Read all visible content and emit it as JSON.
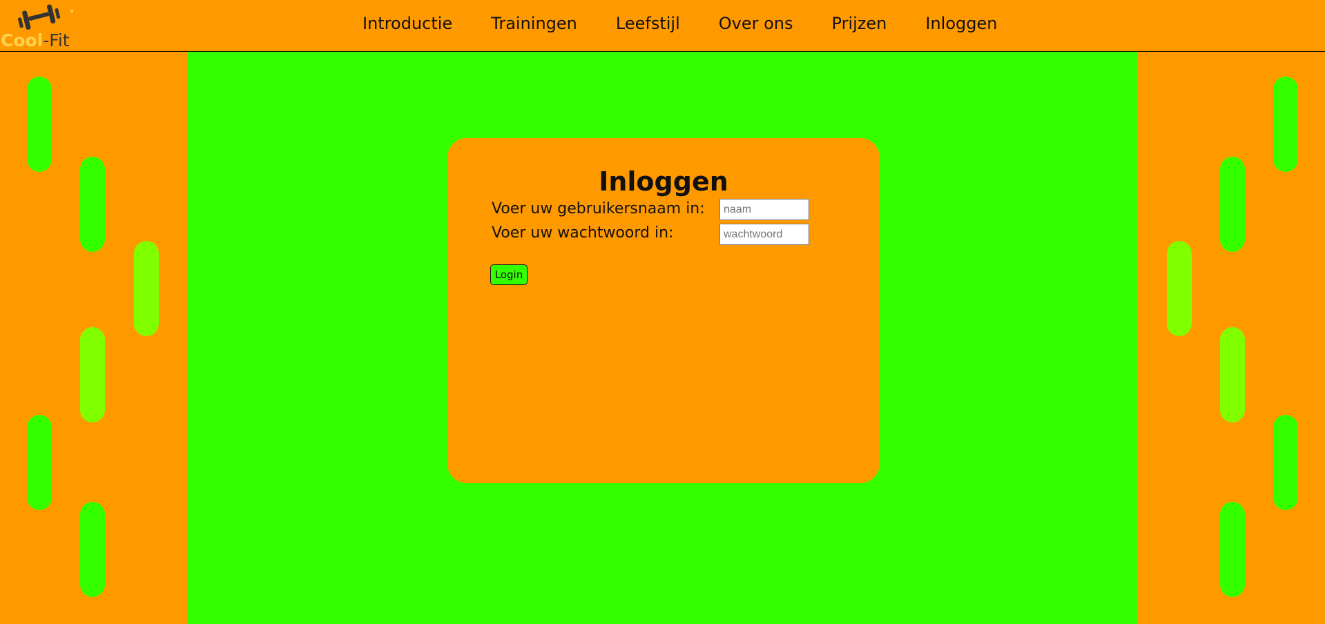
{
  "logo": {
    "cool": "Cool",
    "fit": "-Fit",
    "icon": "dumbbell-icon"
  },
  "nav": {
    "items": [
      {
        "label": "Introductie"
      },
      {
        "label": "Trainingen"
      },
      {
        "label": "Leefstijl"
      },
      {
        "label": "Over ons"
      },
      {
        "label": "Prijzen"
      },
      {
        "label": "Inloggen"
      }
    ]
  },
  "login": {
    "title": "Inloggen",
    "username_label": "Voer uw gebruikersnaam in:",
    "username_placeholder": "naam",
    "username_value": "",
    "password_label": "Voer uw wachtwoord in:",
    "password_placeholder": "wachtwoord",
    "password_value": "",
    "button_label": "Login"
  },
  "colors": {
    "page_orange": "#ff9900",
    "main_green": "#33ff00",
    "lime": "#80ff00",
    "logo_yellow": "#ffd24d"
  }
}
